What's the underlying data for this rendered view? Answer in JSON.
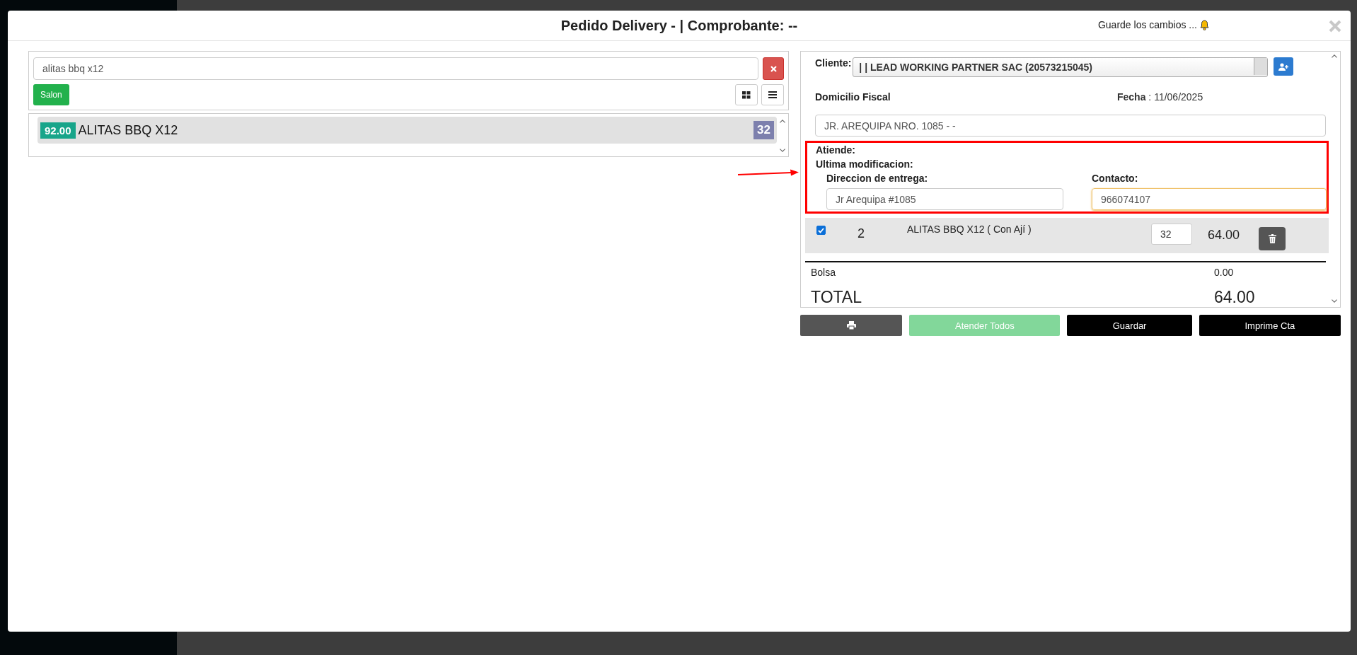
{
  "modal": {
    "title": "Pedido Delivery - | Comprobante: --",
    "notice": "Guarde los cambios ..."
  },
  "search": {
    "value": "alitas bbq x12"
  },
  "filters": [
    {
      "label": "Salon"
    }
  ],
  "products": [
    {
      "price": "92.00",
      "name": "ALITAS BBQ X12",
      "stock": "32"
    }
  ],
  "order": {
    "client_label": "Cliente:",
    "client": "| | LEAD WORKING PARTNER SAC (20573215045)",
    "domicilio_label": "Domicilio Fiscal",
    "fecha": "**Fecha** : 11/06/2025",
    "domicilio": "JR. AREQUIPA NRO. 1085 - -",
    "atiende_label": "Atiende:",
    "ultima_label": "Ultima modificacion:",
    "direccion_label": "Direccion de entrega:",
    "direccion": "Jr Arequipa #1085",
    "contacto_label": "Contacto:",
    "contacto": "966074107",
    "contacto_focused": true
  },
  "items": [
    {
      "checked": true,
      "qty": "2",
      "name": "ALITAS BBQ X12 ( Con Ají )",
      "code": "32",
      "amount": "64.00"
    }
  ],
  "bolsa": {
    "label": "Bolsa",
    "value": "0.00"
  },
  "total": {
    "label": "TOTAL",
    "value": "64.00"
  },
  "actions": [
    {
      "kind": "print"
    },
    {
      "kind": "success",
      "label": "Atender Todos",
      "disabled": true
    },
    {
      "kind": "dark",
      "label": "Guardar",
      "disabled": false
    },
    {
      "kind": "dark",
      "label": "Imprime Cta",
      "disabled": false
    }
  ]
}
